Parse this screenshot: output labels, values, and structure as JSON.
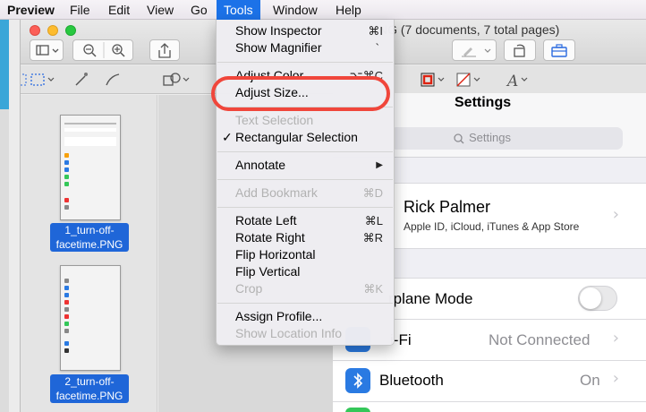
{
  "menubar": {
    "app": "Preview",
    "items": [
      "File",
      "Edit",
      "View",
      "Go",
      "Tools",
      "Window",
      "Help"
    ]
  },
  "window": {
    "title": "NG (7 documents, 7 total pages)"
  },
  "sidebar": {
    "thumbs": [
      {
        "label_line1": "1_turn-off-",
        "label_line2": "facetime.PNG"
      },
      {
        "label_line1": "2_turn-off-",
        "label_line2": "facetime.PNG"
      }
    ]
  },
  "settings": {
    "title": "Settings",
    "search_placeholder": "Settings",
    "profile_name": "Rick Palmer",
    "profile_sub": "Apple ID, iCloud, iTunes & App Store",
    "airplane_label": "rplane Mode",
    "wifi_label": "i-Fi",
    "wifi_value": "Not Connected",
    "bluetooth_label": "Bluetooth",
    "bluetooth_value": "On"
  },
  "tools_menu": {
    "show_inspector": {
      "label": "Show Inspector",
      "shortcut": "⌘I"
    },
    "show_magnifier": {
      "label": "Show Magnifier",
      "shortcut": "`"
    },
    "adjust_color": {
      "label": "Adjust Color...",
      "shortcut": "⌥⌘C"
    },
    "adjust_size": {
      "label": "Adjust Size..."
    },
    "text_selection": {
      "label": "Text Selection"
    },
    "rectangular_selection": {
      "label": "Rectangular Selection",
      "check": "✓"
    },
    "annotate": {
      "label": "Annotate",
      "arrow": "▶"
    },
    "add_bookmark": {
      "label": "Add Bookmark",
      "shortcut": "⌘D"
    },
    "rotate_left": {
      "label": "Rotate Left",
      "shortcut": "⌘L"
    },
    "rotate_right": {
      "label": "Rotate Right",
      "shortcut": "⌘R"
    },
    "flip_horizontal": {
      "label": "Flip Horizontal"
    },
    "flip_vertical": {
      "label": "Flip Vertical"
    },
    "crop": {
      "label": "Crop",
      "shortcut": "⌘K"
    },
    "assign_profile": {
      "label": "Assign Profile..."
    },
    "show_location_info": {
      "label": "Show Location Info"
    }
  },
  "colors": {
    "menu_highlight": "#1c72e8",
    "annotation_ring": "#f0463b",
    "selection_label": "#1f66d8"
  }
}
